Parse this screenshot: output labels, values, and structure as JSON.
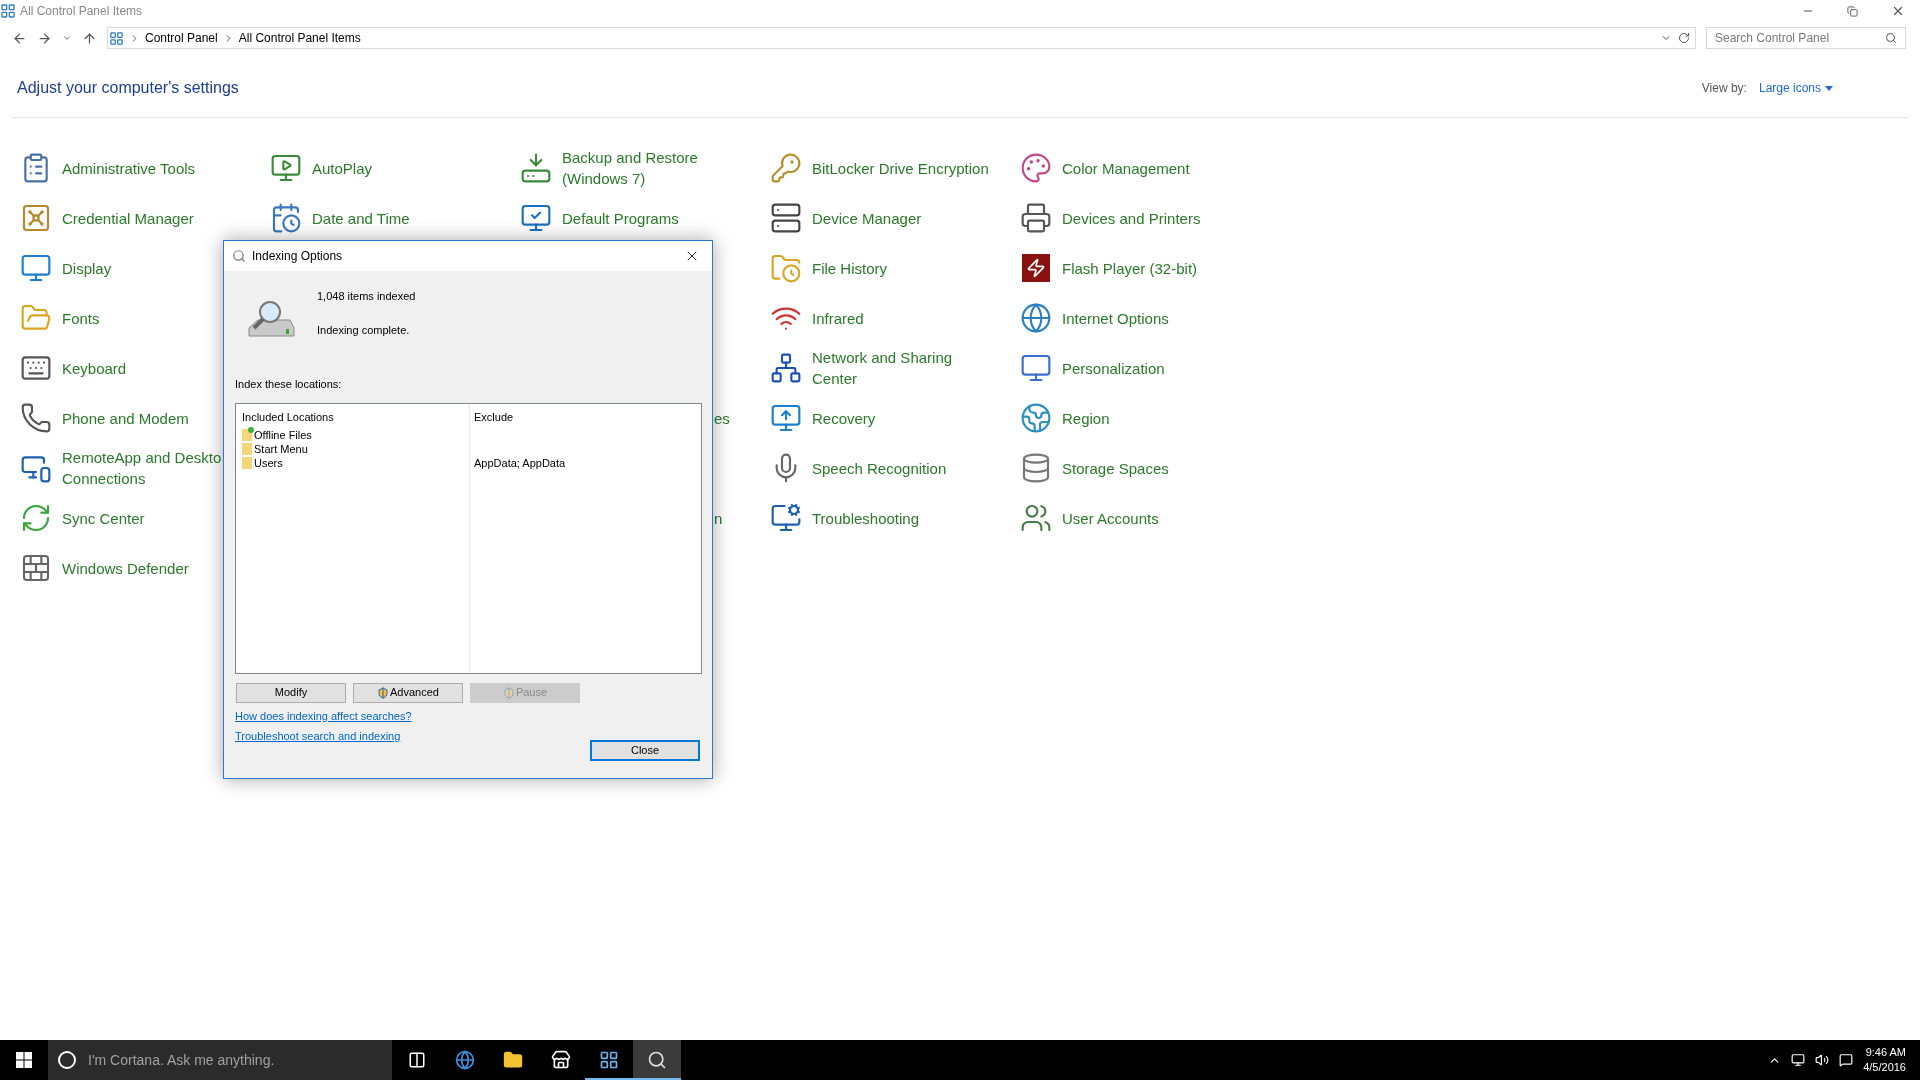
{
  "window": {
    "title": "All Control Panel Items"
  },
  "address_bar": {
    "breadcrumbs": [
      "Control Panel",
      "All Control Panel Items"
    ]
  },
  "search": {
    "placeholder": "Search Control Panel"
  },
  "header": {
    "title": "Adjust your computer's settings",
    "view_by_label": "View by:",
    "view_by_value": "Large icons"
  },
  "columns": [
    [
      "Administrative Tools",
      "Credential Manager",
      "Display",
      "Fonts",
      "Keyboard",
      "Phone and Modem",
      "RemoteApp and Deskto\nConnections",
      "Sync Center",
      "Windows Defender"
    ],
    [
      "AutoPlay",
      "Date and Time"
    ],
    [
      "Backup and Restore (Windows 7)",
      "Default Programs"
    ],
    [
      "BitLocker Drive Encryption",
      "Device Manager",
      "File History",
      "Infrared",
      "Network and Sharing Center",
      "Recovery",
      "Speech Recognition",
      "Troubleshooting"
    ],
    [
      "Color Management",
      "Devices and Printers",
      "Flash Player (32-bit)",
      "Internet Options",
      "Personalization",
      "Region",
      "Storage Spaces",
      "User Accounts"
    ]
  ],
  "covered_fragments": [
    "es",
    "n"
  ],
  "dialog": {
    "title": "Indexing Options",
    "items_indexed": "1,048 items indexed",
    "status": "Indexing complete.",
    "locations_label": "Index these locations:",
    "table": {
      "columns": [
        "Included Locations",
        "Exclude"
      ],
      "rows": [
        {
          "location": "Offline Files",
          "kind": "offline"
        },
        {
          "location": "Start Menu",
          "kind": "folder"
        },
        {
          "location": "Users",
          "exclude": "AppData; AppData",
          "kind": "folder"
        }
      ]
    },
    "buttons": [
      {
        "label": "Modify",
        "shield": false,
        "disabled": false
      },
      {
        "label": "Advanced",
        "shield": true,
        "disabled": false
      },
      {
        "label": "Pause",
        "shield": true,
        "disabled": true
      }
    ],
    "links": [
      "How does indexing affect searches?",
      "Troubleshoot search and indexing"
    ],
    "close_button": "Close"
  },
  "taskbar": {
    "search_placeholder": "I'm Cortana. Ask me anything.",
    "apps": [
      {
        "kind": "task-view",
        "open": false,
        "selected": false
      },
      {
        "kind": "browser",
        "open": false,
        "selected": false
      },
      {
        "kind": "explorer",
        "open": false,
        "selected": false
      },
      {
        "kind": "store",
        "open": false,
        "selected": false
      },
      {
        "kind": "control-panel",
        "open": true,
        "selected": false
      },
      {
        "kind": "indexing",
        "open": true,
        "selected": true
      }
    ],
    "time": "9:46 AM",
    "date": "4/5/2016"
  }
}
